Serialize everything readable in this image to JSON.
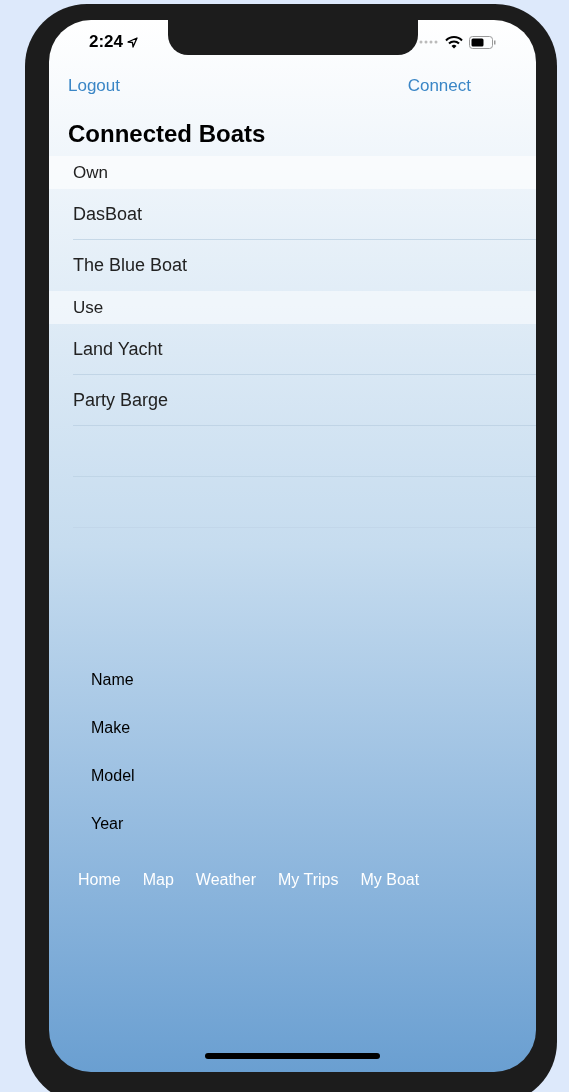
{
  "status_bar": {
    "time": "2:24"
  },
  "nav": {
    "left_button": "Logout",
    "right_button": "Connect"
  },
  "title": "Connected Boats",
  "sections": [
    {
      "header": "Own",
      "rows": [
        {
          "name": "DasBoat"
        },
        {
          "name": "The Blue Boat"
        }
      ]
    },
    {
      "header": "Use",
      "rows": [
        {
          "name": "Land Yacht"
        },
        {
          "name": "Party Barge"
        }
      ]
    }
  ],
  "form_labels": [
    "Name",
    "Make",
    "Model",
    "Year"
  ],
  "tab_bar": [
    "Home",
    "Map",
    "Weather",
    "My Trips",
    "My Boat"
  ]
}
